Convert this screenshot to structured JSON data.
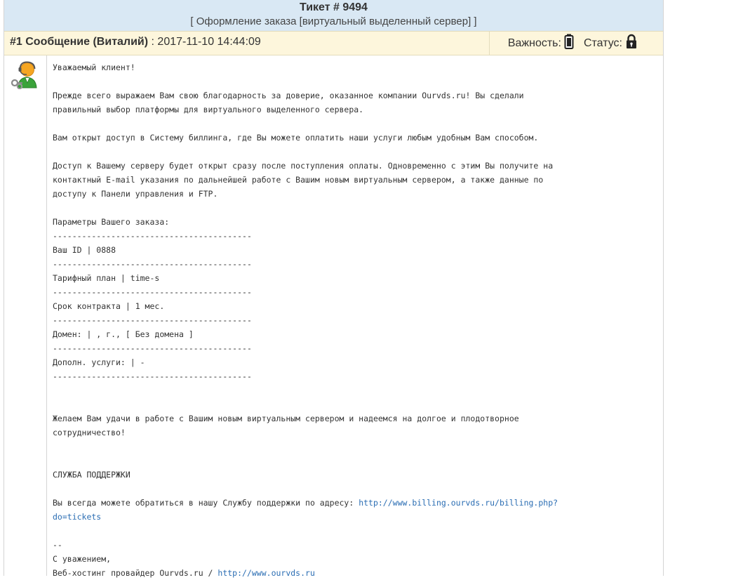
{
  "ticket": {
    "title": "Тикет # 9494",
    "subject": "[ Оформление заказа [виртуальный выделенный сервер] ]"
  },
  "message": {
    "label": "#1 Сообщение (Виталий)",
    "date": " : 2017-11-10 14:44:09",
    "importance_label": "Важность:",
    "status_label": "Статус:",
    "importance_icon": "battery-icon",
    "status_icon": "lock-icon"
  },
  "body": {
    "greeting": "Уважаемый клиент!",
    "para1": "Прежде всего выражаем Вам свою благодарность за доверие, оказанное компании Ourvds.ru! Вы сделали\nправильный выбор платформы для виртуального выделенного сервера.",
    "para2": "Вам открыт доступ в Систему биллинга, где Вы можете оплатить наши услуги любым удобным Вам способом.",
    "para3": "Доступ к Вашему серверу будет открыт сразу после поступления оплаты. Одновременно с этим Вы получите на\nконтактный E-mail указания по дальнейшей работе с Вашим новым виртуальным сервером, а также данные по\nдоступу к Панели управления и FTP.",
    "params_title": "Параметры Вашего заказа:",
    "separator": "-----------------------------------------",
    "params": [
      "Ваш ID | 0888",
      "Тарифный план | time-s",
      "Срок контракта | 1 мес.",
      "Домен: | , г., [ Без домена ]",
      "Дополн. услуги: | -"
    ],
    "wish": "Желаем Вам удачи в работе с Вашим новым виртуальным сервером и надеемся на долгое и плодотворное\nсотрудничество!",
    "support_title": "СЛУЖБА ПОДДЕРЖКИ",
    "support_text": "Вы всегда можете обратиться в нашу Службу поддержки по адресу: ",
    "support_link": "http://www.billing.ourvds.ru/billing.php?\ndo=tickets",
    "sig_dash": "--",
    "sig_regards": "С уважением,",
    "sig_company": "Веб-хостинг провайдер Ourvds.ru / ",
    "sig_link": "http://www.ourvds.ru"
  },
  "colors": {
    "header_bg": "#d9e8f4",
    "message_header_bg": "#fdf6dc",
    "link": "#2a6db3"
  }
}
